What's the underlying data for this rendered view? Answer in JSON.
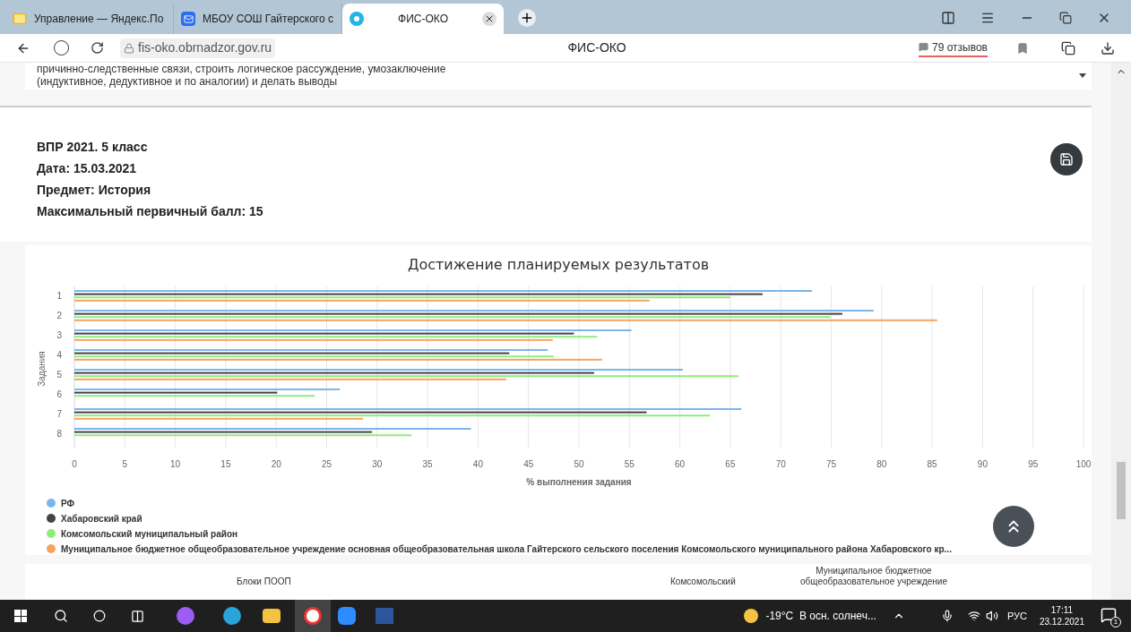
{
  "browser": {
    "tabs": [
      {
        "title": "Управление — Яндекс.По",
        "selected": false
      },
      {
        "title": "МБОУ СОШ Гайтерского с",
        "selected": false
      },
      {
        "title": "ФИС-ОКО",
        "selected": true
      }
    ],
    "address": "fis-oko.obrnadzor.gov.ru",
    "page_title": "ФИС-ОКО",
    "reviews": "79 отзывов"
  },
  "description_lines": [
    "причинно-следственные связи, строить логическое рассуждение, умозаключение",
    "(индуктивное, дедуктивное и по аналогии) и делать выводы"
  ],
  "info": [
    "ВПР 2021. 5 класс",
    "Дата: 15.03.2021",
    "Предмет: История",
    "Максимальный первичный балл: 15"
  ],
  "chart": {
    "chart_data": {
      "type": "bar",
      "orientation": "horizontal",
      "title": "Достижение планируемых результатов",
      "xlabel": "% выполнения задания",
      "ylabel": "Задания",
      "categories": [
        "1",
        "2",
        "3",
        "4",
        "5",
        "6",
        "7",
        "8"
      ],
      "series": [
        {
          "name": "РФ",
          "color": "#7cb5ec",
          "values": [
            73.1,
            79.2,
            55.2,
            46.9,
            60.3,
            26.3,
            66.1,
            39.3
          ]
        },
        {
          "name": "Хабаровский край",
          "color": "#434348",
          "values": [
            68.2,
            76.1,
            49.5,
            43.1,
            51.5,
            20.1,
            56.7,
            29.5
          ]
        },
        {
          "name": "Комсомольский муниципальный район",
          "color": "#90ed7d",
          "values": [
            65,
            74.9,
            51.8,
            47.5,
            65.8,
            23.8,
            63,
            33.4
          ]
        },
        {
          "name": "Муниципальное бюджетное общеобразовательное учреждение основная общеобразовательная школа Гайтерского сельского поселения Комсомольского муниципального района Хабаровского кр...",
          "color": "#f7a35c",
          "values": [
            57,
            85.5,
            47.4,
            52.3,
            42.8,
            null,
            28.6,
            null
          ]
        }
      ],
      "xlim": [
        0,
        100
      ],
      "grid": true,
      "xticks": [
        0,
        5,
        10,
        15,
        20,
        25,
        30,
        35,
        40,
        45,
        50,
        55,
        60,
        65,
        70,
        75,
        80,
        85,
        90,
        95,
        100
      ]
    }
  },
  "table_header": [
    "Блоки ПООП",
    "Комсомольский",
    "Муниципальное бюджетное",
    "общеобразовательное учреждение"
  ],
  "taskbar": {
    "weather": "-19°C  В осн. солнеч...",
    "language": "РУС",
    "time": "17:11",
    "date": "23.12.2021",
    "notifications": "1"
  }
}
